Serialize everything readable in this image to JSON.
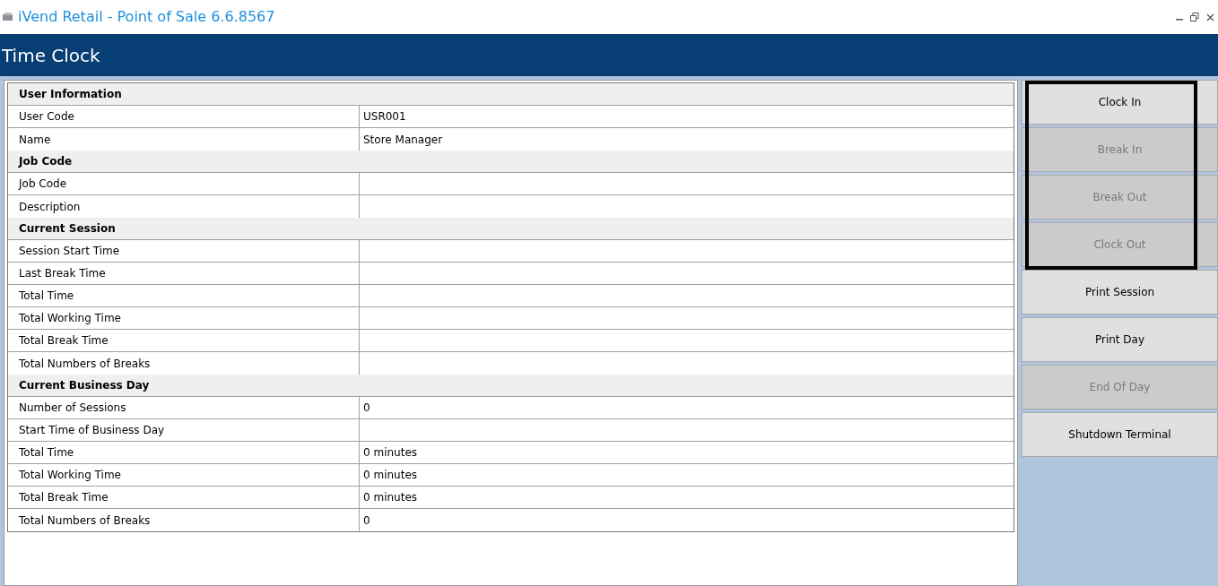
{
  "window": {
    "title": "iVend Retail - Point of Sale 6.6.8567"
  },
  "header": {
    "title": "Time Clock"
  },
  "sections": [
    {
      "title": "User Information",
      "rows": [
        {
          "label": "User Code",
          "value": "USR001"
        },
        {
          "label": "Name",
          "value": "Store Manager"
        }
      ]
    },
    {
      "title": "Job Code",
      "rows": [
        {
          "label": "Job Code",
          "value": ""
        },
        {
          "label": "Description",
          "value": ""
        }
      ]
    },
    {
      "title": "Current Session",
      "rows": [
        {
          "label": "Session Start Time",
          "value": ""
        },
        {
          "label": "Last Break Time",
          "value": ""
        },
        {
          "label": "Total Time",
          "value": ""
        },
        {
          "label": "Total Working Time",
          "value": ""
        },
        {
          "label": "Total Break Time",
          "value": ""
        },
        {
          "label": "Total Numbers of Breaks",
          "value": ""
        }
      ]
    },
    {
      "title": "Current Business Day",
      "rows": [
        {
          "label": "Number of Sessions",
          "value": "0"
        },
        {
          "label": "Start Time of Business Day",
          "value": ""
        },
        {
          "label": "Total Time",
          "value": "0 minutes"
        },
        {
          "label": "Total Working Time",
          "value": "0 minutes"
        },
        {
          "label": "Total Break Time",
          "value": "0 minutes"
        },
        {
          "label": "Total Numbers of Breaks",
          "value": "0"
        }
      ]
    }
  ],
  "buttons": [
    {
      "label": "Clock In",
      "disabled": false
    },
    {
      "label": "Break In",
      "disabled": true
    },
    {
      "label": "Break Out",
      "disabled": true
    },
    {
      "label": "Clock Out",
      "disabled": true
    },
    {
      "label": "Print Session",
      "disabled": false
    },
    {
      "label": "Print Day",
      "disabled": false
    },
    {
      "label": "End Of Day",
      "disabled": true
    },
    {
      "label": "Shutdown Terminal",
      "disabled": false
    }
  ]
}
